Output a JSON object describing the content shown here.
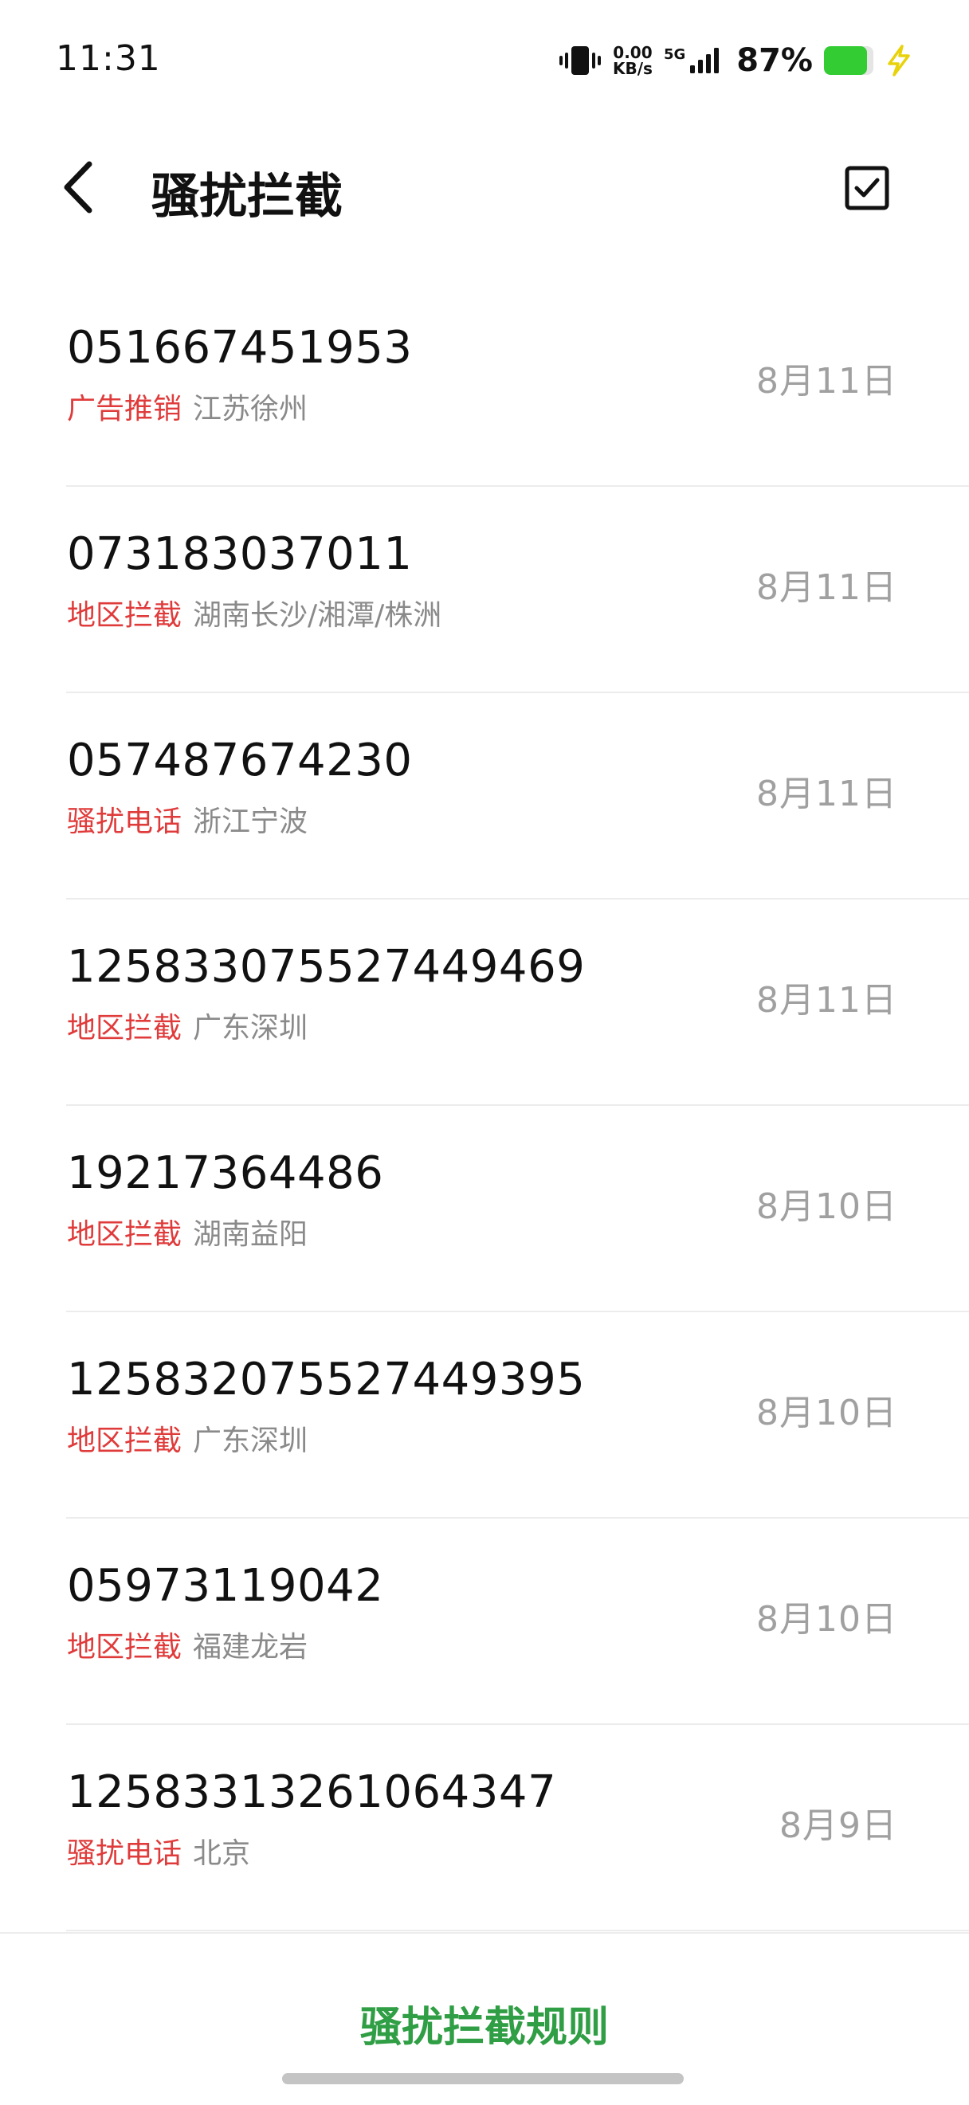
{
  "status_bar": {
    "time": "11:31",
    "net_speed_value": "0.00",
    "net_speed_unit": "KB/s",
    "network_type": "5G",
    "battery_percent": "87%",
    "battery_level": 0.87,
    "battery_color": "#33cc33"
  },
  "header": {
    "title": "骚扰拦截"
  },
  "items": [
    {
      "number": "051667451953",
      "tag": "广告推销",
      "location": "江苏徐州",
      "date": "8月11日"
    },
    {
      "number": "073183037011",
      "tag": "地区拦截",
      "location": "湖南长沙/湘潭/株洲",
      "date": "8月11日"
    },
    {
      "number": "057487674230",
      "tag": "骚扰电话",
      "location": "浙江宁波",
      "date": "8月11日"
    },
    {
      "number": "1258330755274494 69",
      "tag": "地区拦截",
      "location": "广东深圳",
      "date": "8月11日"
    },
    {
      "number": "19217364486",
      "tag": "地区拦截",
      "location": "湖南益阳",
      "date": "8月10日"
    },
    {
      "number": "1258320755274493 95",
      "tag": "地区拦截",
      "location": "广东深圳",
      "date": "8月10日"
    },
    {
      "number": "05973119042",
      "tag": "地区拦截",
      "location": "福建龙岩",
      "date": "8月10日"
    },
    {
      "number": "12583313261064347",
      "tag": "骚扰电话",
      "location": "北京",
      "date": "8月9日"
    }
  ],
  "bottom": {
    "rules_label": "骚扰拦截规则"
  },
  "colors": {
    "accent_green": "#2f9e44",
    "tag_red": "#e03b3b"
  }
}
